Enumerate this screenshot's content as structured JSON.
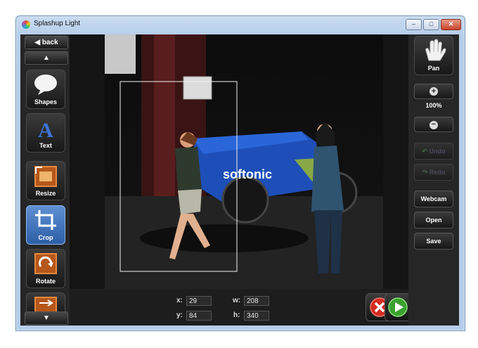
{
  "window": {
    "title": "Splashup Light"
  },
  "left_panel": {
    "back_label": "back",
    "tools": [
      "Shapes",
      "Text",
      "Resize",
      "Crop",
      "Rotate"
    ]
  },
  "right_panel": {
    "pan_label": "Pan",
    "zoom_level": "100%",
    "undo_label": "Undo",
    "redo_label": "Redo",
    "webcam_label": "Webcam",
    "open_label": "Open",
    "save_label": "Save"
  },
  "crop": {
    "x_label": "x:",
    "x_value": "29",
    "y_label": "y:",
    "y_value": "84",
    "w_label": "w:",
    "w_value": "208",
    "h_label": "h:",
    "h_value": "340"
  },
  "photo": {
    "bike_brand": "softonic"
  },
  "colors": {
    "accent": "#3d73c5",
    "cancel": "#d62b20",
    "confirm": "#3aa12f"
  }
}
